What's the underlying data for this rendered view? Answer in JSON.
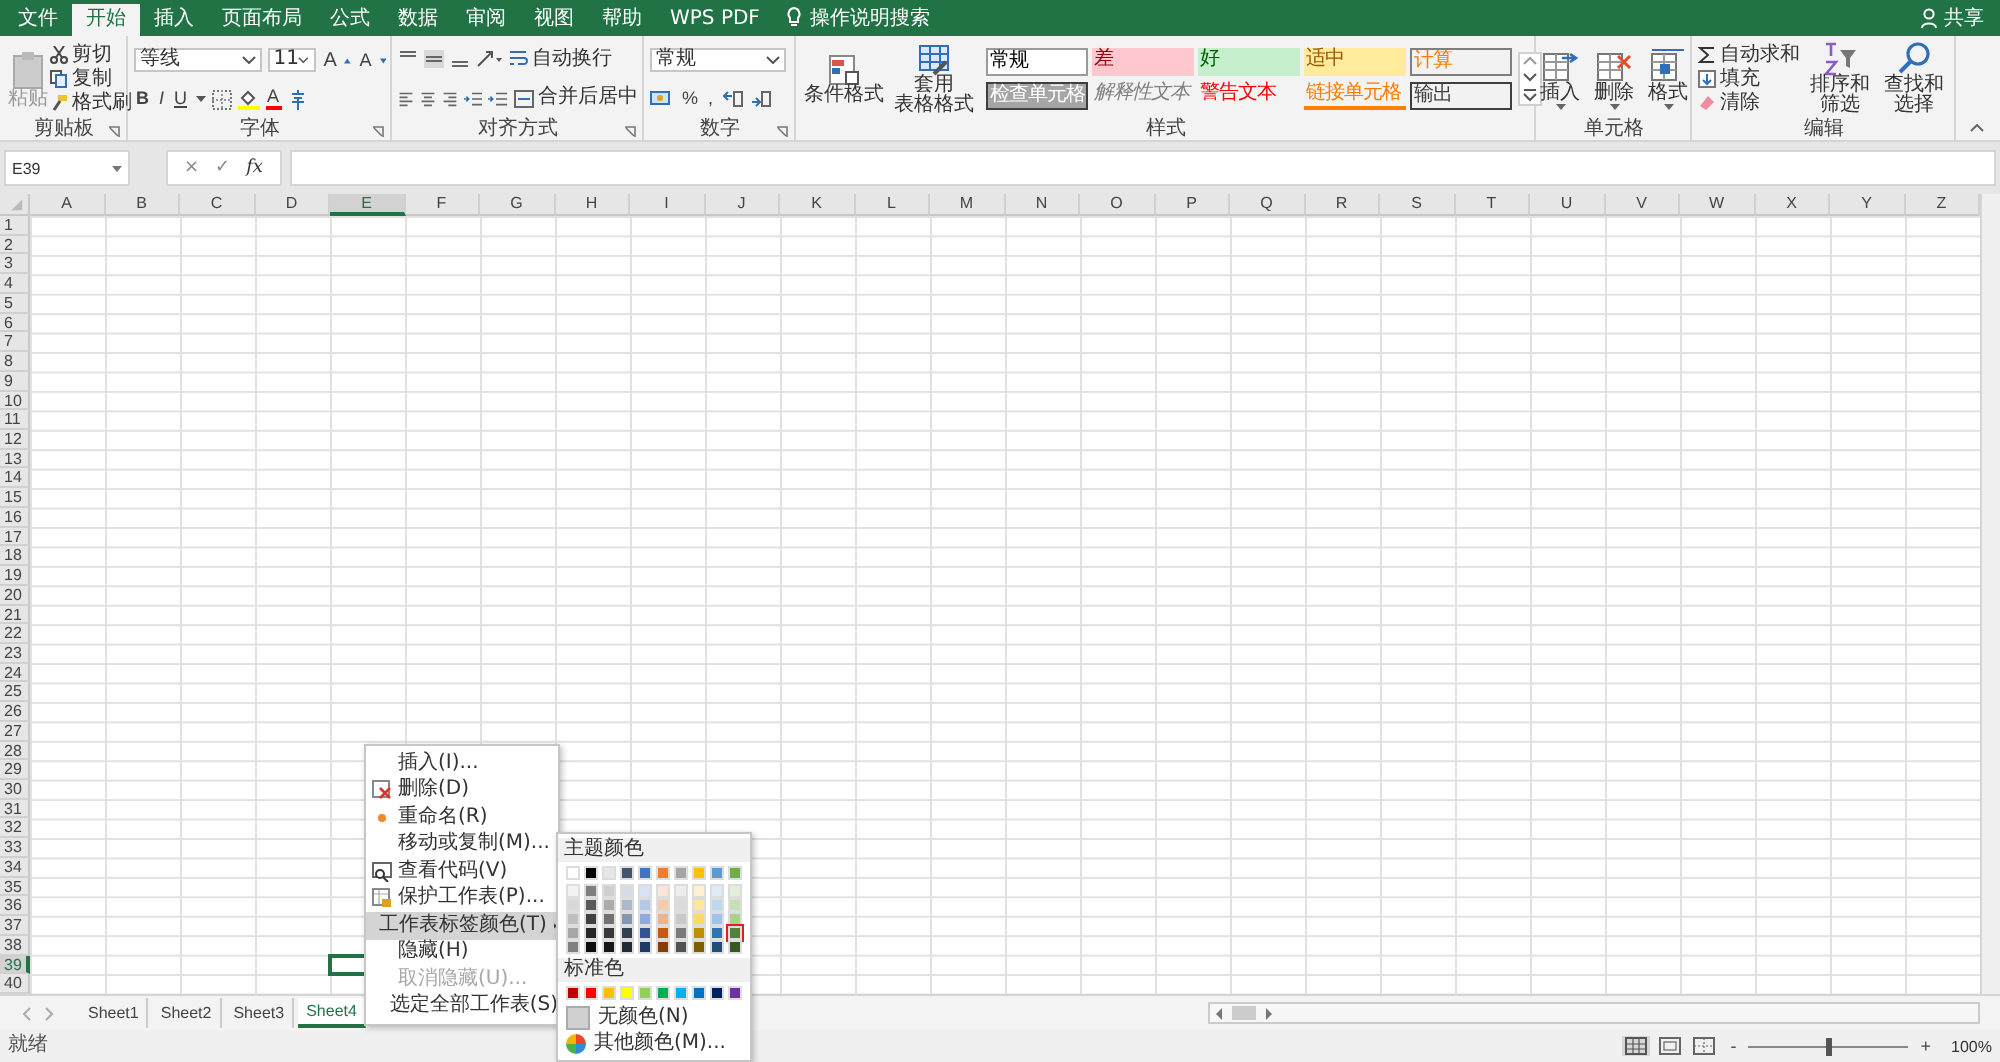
{
  "menu_tabs": [
    {
      "label": "文件",
      "selected": false
    },
    {
      "label": "开始",
      "selected": true
    },
    {
      "label": "插入",
      "selected": false
    },
    {
      "label": "页面布局",
      "selected": false
    },
    {
      "label": "公式",
      "selected": false
    },
    {
      "label": "数据",
      "selected": false
    },
    {
      "label": "审阅",
      "selected": false
    },
    {
      "label": "视图",
      "selected": false
    },
    {
      "label": "帮助",
      "selected": false
    },
    {
      "label": "WPS PDF",
      "selected": false
    }
  ],
  "tell_me": "操作说明搜索",
  "share": "共享",
  "ribbon": {
    "clipboard": {
      "paste": "粘贴",
      "cut": "剪切",
      "copy": "复制",
      "format_painter": "格式刷",
      "label": "剪贴板"
    },
    "font": {
      "name": "等线",
      "size": "11",
      "grow": "A",
      "shrink": "A",
      "bold": "B",
      "italic": "I",
      "underline": "U",
      "font_color": "A",
      "label": "字体"
    },
    "alignment": {
      "wrap": "自动换行",
      "merge": "合并后居中",
      "label": "对齐方式"
    },
    "number": {
      "format": "常规",
      "percent": "%",
      "comma": ",",
      "label": "数字"
    },
    "styles": {
      "conditional": "条件格式",
      "table_format": [
        "套用",
        "表格格式"
      ],
      "label": "样式",
      "cell_styles": [
        {
          "label": "常规",
          "kind": "normal"
        },
        {
          "label": "差",
          "kind": "bad"
        },
        {
          "label": "好",
          "kind": "good"
        },
        {
          "label": "适中",
          "kind": "neutral"
        },
        {
          "label": "计算",
          "kind": "calculation"
        },
        {
          "label": "检查单元格",
          "kind": "check"
        },
        {
          "label": "解释性文本",
          "kind": "explanatory"
        },
        {
          "label": "警告文本",
          "kind": "warning"
        },
        {
          "label": "链接单元格",
          "kind": "linked"
        },
        {
          "label": "输出",
          "kind": "output"
        }
      ]
    },
    "cells": {
      "label": "单元格",
      "buttons": [
        {
          "label": "插入",
          "kind": "insert"
        },
        {
          "label": "删除",
          "kind": "delete"
        },
        {
          "label": "格式",
          "kind": "format"
        }
      ]
    },
    "editing": {
      "autosum": "自动求和",
      "fill": "填充",
      "clear": "清除",
      "sort": "排序和筛选",
      "find": "查找和选择",
      "label": "编辑"
    }
  },
  "formula_bar": {
    "name_box": "E39",
    "cancel": "×",
    "enter": "✓",
    "function": "fx"
  },
  "columns": [
    {
      "label": "A",
      "selected": false
    },
    {
      "label": "B",
      "selected": false
    },
    {
      "label": "C",
      "selected": false
    },
    {
      "label": "D",
      "selected": false
    },
    {
      "label": "E",
      "selected": true
    },
    {
      "label": "F",
      "selected": false
    },
    {
      "label": "G",
      "selected": false
    },
    {
      "label": "H",
      "selected": false
    },
    {
      "label": "I",
      "selected": false
    },
    {
      "label": "J",
      "selected": false
    },
    {
      "label": "K",
      "selected": false
    },
    {
      "label": "L",
      "selected": false
    },
    {
      "label": "M",
      "selected": false
    },
    {
      "label": "N",
      "selected": false
    },
    {
      "label": "O",
      "selected": false
    },
    {
      "label": "P",
      "selected": false
    },
    {
      "label": "Q",
      "selected": false
    },
    {
      "label": "R",
      "selected": false
    },
    {
      "label": "S",
      "selected": false
    },
    {
      "label": "T",
      "selected": false
    },
    {
      "label": "U",
      "selected": false
    },
    {
      "label": "V",
      "selected": false
    },
    {
      "label": "W",
      "selected": false
    },
    {
      "label": "X",
      "selected": false
    },
    {
      "label": "Y",
      "selected": false
    },
    {
      "label": "Z",
      "selected": false
    }
  ],
  "rows": [
    {
      "label": "1",
      "selected": false
    },
    {
      "label": "2",
      "selected": false
    },
    {
      "label": "3",
      "selected": false
    },
    {
      "label": "4",
      "selected": false
    },
    {
      "label": "5",
      "selected": false
    },
    {
      "label": "6",
      "selected": false
    },
    {
      "label": "7",
      "selected": false
    },
    {
      "label": "8",
      "selected": false
    },
    {
      "label": "9",
      "selected": false
    },
    {
      "label": "10",
      "selected": false
    },
    {
      "label": "11",
      "selected": false
    },
    {
      "label": "12",
      "selected": false
    },
    {
      "label": "13",
      "selected": false
    },
    {
      "label": "14",
      "selected": false
    },
    {
      "label": "15",
      "selected": false
    },
    {
      "label": "16",
      "selected": false
    },
    {
      "label": "17",
      "selected": false
    },
    {
      "label": "18",
      "selected": false
    },
    {
      "label": "19",
      "selected": false
    },
    {
      "label": "20",
      "selected": false
    },
    {
      "label": "21",
      "selected": false
    },
    {
      "label": "22",
      "selected": false
    },
    {
      "label": "23",
      "selected": false
    },
    {
      "label": "24",
      "selected": false
    },
    {
      "label": "25",
      "selected": false
    },
    {
      "label": "26",
      "selected": false
    },
    {
      "label": "27",
      "selected": false
    },
    {
      "label": "28",
      "selected": false
    },
    {
      "label": "29",
      "selected": false
    },
    {
      "label": "30",
      "selected": false
    },
    {
      "label": "31",
      "selected": false
    },
    {
      "label": "32",
      "selected": false
    },
    {
      "label": "33",
      "selected": false
    },
    {
      "label": "34",
      "selected": false
    },
    {
      "label": "35",
      "selected": false
    },
    {
      "label": "36",
      "selected": false
    },
    {
      "label": "37",
      "selected": false
    },
    {
      "label": "38",
      "selected": false
    },
    {
      "label": "39",
      "selected": true
    },
    {
      "label": "40",
      "selected": false
    }
  ],
  "sheet_tabs": [
    {
      "label": "Sheet1",
      "selected": false
    },
    {
      "label": "Sheet2",
      "selected": false
    },
    {
      "label": "Sheet3",
      "selected": false
    },
    {
      "label": "Sheet4",
      "selected": true
    }
  ],
  "context_menu": [
    {
      "label": "插入(I)...",
      "kind": "none",
      "selected": false,
      "disabled": false,
      "submenu": false
    },
    {
      "label": "删除(D)",
      "kind": "delete",
      "selected": false,
      "disabled": false,
      "submenu": false
    },
    {
      "label": "重命名(R)",
      "kind": "rename",
      "selected": false,
      "disabled": false,
      "submenu": false
    },
    {
      "label": "移动或复制(M)...",
      "kind": "none",
      "selected": false,
      "disabled": false,
      "submenu": false
    },
    {
      "label": "查看代码(V)",
      "kind": "code",
      "selected": false,
      "disabled": false,
      "submenu": false
    },
    {
      "label": "保护工作表(P)...",
      "kind": "protect",
      "selected": false,
      "disabled": false,
      "submenu": false
    },
    {
      "label": "工作表标签颜色(T)",
      "kind": "none",
      "selected": true,
      "disabled": false,
      "submenu": true
    },
    {
      "label": "隐藏(H)",
      "kind": "none",
      "selected": false,
      "disabled": false,
      "submenu": false
    },
    {
      "label": "取消隐藏(U)...",
      "kind": "none",
      "selected": false,
      "disabled": true,
      "submenu": false
    },
    {
      "label": "选定全部工作表(S)",
      "kind": "none",
      "selected": false,
      "disabled": false,
      "submenu": false
    }
  ],
  "tab_color_menu": {
    "theme_heading": "主题颜色",
    "standard_heading": "标准色",
    "no_color": "无颜色(N)",
    "more_colors": "其他颜色(M)...",
    "theme_colors": [
      [
        {
          "color": "#ffffff",
          "selected": false
        },
        {
          "color": "#000000",
          "selected": false
        },
        {
          "color": "#e7e6e6",
          "selected": false
        },
        {
          "color": "#44546a",
          "selected": false
        },
        {
          "color": "#4472c4",
          "selected": false
        },
        {
          "color": "#ed7d31",
          "selected": false
        },
        {
          "color": "#a5a5a5",
          "selected": false
        },
        {
          "color": "#ffc000",
          "selected": false
        },
        {
          "color": "#5b9bd5",
          "selected": false
        },
        {
          "color": "#70ad47",
          "selected": false
        }
      ],
      [
        {
          "color": "#f2f2f2",
          "selected": false
        },
        {
          "color": "#7f7f7f",
          "selected": false
        },
        {
          "color": "#d0cece",
          "selected": false
        },
        {
          "color": "#d6dce5",
          "selected": false
        },
        {
          "color": "#dae3f3",
          "selected": false
        },
        {
          "color": "#fbe5d6",
          "selected": false
        },
        {
          "color": "#ededed",
          "selected": false
        },
        {
          "color": "#fff2cc",
          "selected": false
        },
        {
          "color": "#deebf7",
          "selected": false
        },
        {
          "color": "#e2f0d9",
          "selected": false
        }
      ],
      [
        {
          "color": "#d9d9d9",
          "selected": false
        },
        {
          "color": "#595959",
          "selected": false
        },
        {
          "color": "#afabab",
          "selected": false
        },
        {
          "color": "#adb9ca",
          "selected": false
        },
        {
          "color": "#b4c7e7",
          "selected": false
        },
        {
          "color": "#f8cbad",
          "selected": false
        },
        {
          "color": "#dbdbdb",
          "selected": false
        },
        {
          "color": "#ffe699",
          "selected": false
        },
        {
          "color": "#bdd7ee",
          "selected": false
        },
        {
          "color": "#c5e0b4",
          "selected": false
        }
      ],
      [
        {
          "color": "#bfbfbf",
          "selected": false
        },
        {
          "color": "#404040",
          "selected": false
        },
        {
          "color": "#767171",
          "selected": false
        },
        {
          "color": "#8497b0",
          "selected": false
        },
        {
          "color": "#8faadc",
          "selected": false
        },
        {
          "color": "#f4b183",
          "selected": false
        },
        {
          "color": "#c9c9c9",
          "selected": false
        },
        {
          "color": "#ffd966",
          "selected": false
        },
        {
          "color": "#9dc3e6",
          "selected": false
        },
        {
          "color": "#a9d18e",
          "selected": false
        }
      ],
      [
        {
          "color": "#a6a6a6",
          "selected": false
        },
        {
          "color": "#262626",
          "selected": false
        },
        {
          "color": "#3b3838",
          "selected": false
        },
        {
          "color": "#333f50",
          "selected": false
        },
        {
          "color": "#2f5597",
          "selected": false
        },
        {
          "color": "#c55a11",
          "selected": false
        },
        {
          "color": "#7b7b7b",
          "selected": false
        },
        {
          "color": "#bf9000",
          "selected": false
        },
        {
          "color": "#2e75b6",
          "selected": false
        },
        {
          "color": "#538135",
          "selected": true
        }
      ],
      [
        {
          "color": "#808080",
          "selected": false
        },
        {
          "color": "#0d0d0d",
          "selected": false
        },
        {
          "color": "#181717",
          "selected": false
        },
        {
          "color": "#222a35",
          "selected": false
        },
        {
          "color": "#203864",
          "selected": false
        },
        {
          "color": "#843c0c",
          "selected": false
        },
        {
          "color": "#525252",
          "selected": false
        },
        {
          "color": "#7f6000",
          "selected": false
        },
        {
          "color": "#1f4e79",
          "selected": false
        },
        {
          "color": "#385723",
          "selected": false
        }
      ]
    ],
    "standard_colors": [
      {
        "color": "#c00000",
        "selected": false
      },
      {
        "color": "#ff0000",
        "selected": false
      },
      {
        "color": "#ffc000",
        "selected": false
      },
      {
        "color": "#ffff00",
        "selected": false
      },
      {
        "color": "#92d050",
        "selected": false
      },
      {
        "color": "#00b050",
        "selected": false
      },
      {
        "color": "#00b0f0",
        "selected": false
      },
      {
        "color": "#0070c0",
        "selected": false
      },
      {
        "color": "#002060",
        "selected": false
      },
      {
        "color": "#7030a0",
        "selected": false
      }
    ]
  },
  "status_bar": {
    "status": "就绪",
    "zoom_out": "-",
    "zoom_in": "+",
    "zoom": "100%",
    "level": 0.5
  }
}
